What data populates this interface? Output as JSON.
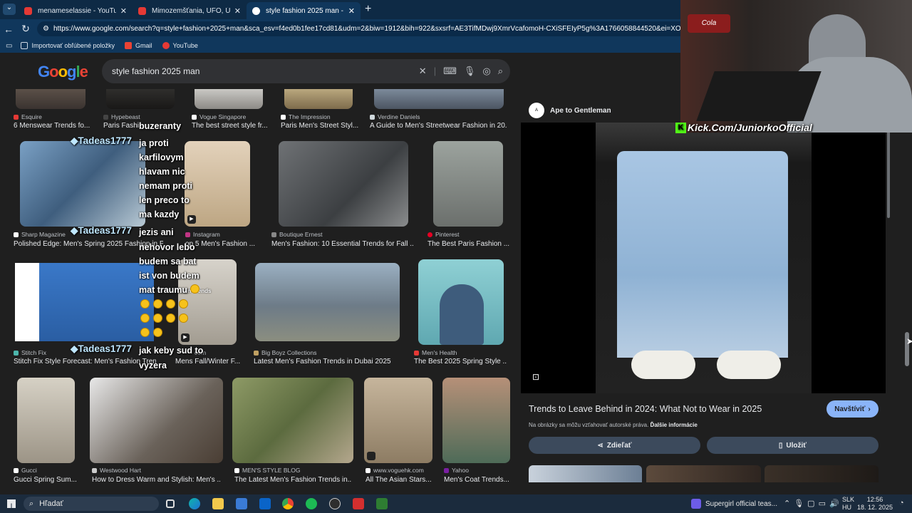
{
  "browser": {
    "tabs": [
      {
        "title": "menameselassie - YouTube"
      },
      {
        "title": "Mimozemšťania, UFO, Únosy a Ar"
      },
      {
        "title": "style fashion 2025 man - Hľadať G"
      }
    ],
    "url": "https://www.google.com/search?q=style+fashion+2025+man&sca_esv=f4ed0b1fee17cd81&udm=2&biw=1912&bih=922&sxsrf=AE3TifMDwj9XmrVcafomoH-CXiSFEIyP5g%3A1766058844520&ei=XOtDaaK6H4SK9u",
    "bookmarks": [
      "Importovať obľúbené položky",
      "Gmail",
      "YouTube"
    ]
  },
  "google": {
    "logo": "Google",
    "query": "style fashion 2025 man"
  },
  "results": [
    {
      "source": "Esquire",
      "caption": "6 Menswear Trends fo..."
    },
    {
      "source": "Hypebeast",
      "caption": "Paris Fashio"
    },
    {
      "source": "Vogue Singapore",
      "caption": "The best street style fr..."
    },
    {
      "source": "The Impression",
      "caption": "Paris Men's Street Styl..."
    },
    {
      "source": "Verdine Daniels",
      "caption": "A Guide to Men's Streetwear Fashion in 20..."
    },
    {
      "source": "Sharp Magazine",
      "caption": "Polished Edge: Men's Spring 2025 Fashion in Pi..."
    },
    {
      "source": "Instagram",
      "caption": "op 5 Men's Fashion ..."
    },
    {
      "source": "Boutique Ernest",
      "caption": "Men's Fashion: 10 Essential Trends for Fall ..."
    },
    {
      "source": "Pinterest",
      "caption": "The Best Paris Fashion ..."
    },
    {
      "source": "Stitch Fix",
      "caption": "Stitch Fix Style Forecast: Men's Fashion Trend..."
    },
    {
      "source": "com",
      "caption": "Mens Fall/Winter F..."
    },
    {
      "source": "Big Boyz Collections",
      "caption": "Latest Men's Fashion Trends in Dubai 2025"
    },
    {
      "source": "Men's Health",
      "caption": "The Best 2025 Spring Style ..."
    },
    {
      "source": "Gucci",
      "caption": "Gucci Spring Sum..."
    },
    {
      "source": "Westwood Hart",
      "caption": "How to Dress Warm and Stylish: Men's ..."
    },
    {
      "source": "MEN'S STYLE BLOG",
      "caption": "The Latest Men's Fashion Trends in..."
    },
    {
      "source": "www.voguehk.com",
      "caption": "All The Asian Stars..."
    },
    {
      "source": "Yahoo",
      "caption": "Men's Coat Trends..."
    }
  ],
  "overlay": {
    "name": "Tadeas1777",
    "messages": [
      "buzeranty",
      "ja proti",
      "karfilovym",
      "hlavam nic",
      "nemam proti",
      "len preco to",
      "ma kazdy",
      "jezis ani",
      "nehovor lebo",
      "budem sa bat",
      "ist von budem",
      "mat traumu",
      "jak keby sud to",
      "vyzera"
    ],
    "video_label": "ion Trends"
  },
  "panel": {
    "site": "Ape to Gentleman",
    "title": "Trends to Leave Behind in 2024: What Not to Wear in 2025",
    "visit": "Navštíviť",
    "copyright": "Na obrázky sa môžu vzťahovať autorské práva.",
    "more_info": "Ďalšie informácie",
    "share": "Zdieľať",
    "save": "Uložiť"
  },
  "stream": {
    "kick": "Kick.Com/JuniorkoOfficial",
    "cola": "Cola"
  },
  "taskbar": {
    "search": "Hľadať",
    "notification": "Supergirl official teas...",
    "lang1": "SLK",
    "lang2": "HU",
    "time": "12:56",
    "date": "18. 12. 2025"
  },
  "colors": {
    "google_blue": "#4285f4",
    "google_red": "#ea4335",
    "google_yellow": "#fbbc05",
    "google_green": "#34a853",
    "visit_button": "#8ab4f8"
  }
}
